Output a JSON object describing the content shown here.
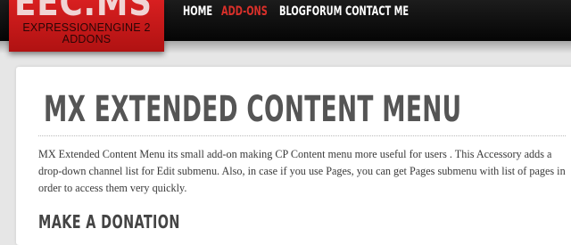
{
  "header": {
    "logo_title": "EEC.MS",
    "logo_subtitle_line1": "EXPRESSIONENGINE 2",
    "logo_subtitle_line2": "ADDONS",
    "nav": [
      "HOME",
      "ADD-ONS",
      "BLOG",
      "FORUM",
      "CONTACT ME"
    ],
    "active_nav": "ADD-ONS"
  },
  "main": {
    "title": "MX EXTENDED CONTENT MENU",
    "description": "MX Extended Content Menu its small add-on making CP Content menu more useful for users . This Accessory adds a drop-down channel list for Edit submenu. Also, in case if you use Pages, you can get Pages submenu with list of pages in order to access them very quickly.",
    "section_heading": "MAKE A DONATION"
  },
  "colors": {
    "brand_red": "#c81a1a",
    "active_nav": "#d9302a",
    "topbar": "#0d0d0d",
    "page_background": "#e6e6e6"
  }
}
